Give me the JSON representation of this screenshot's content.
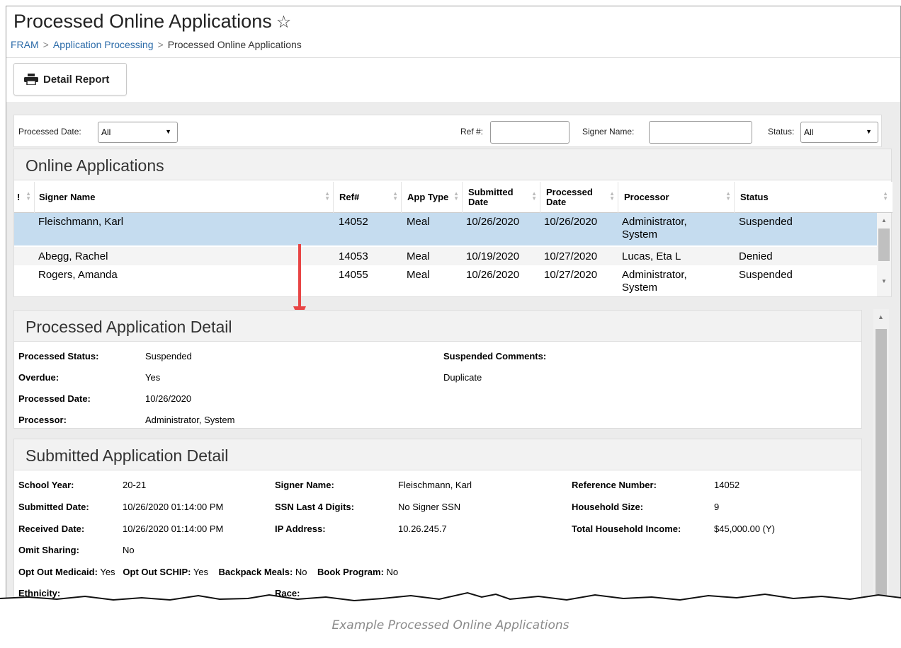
{
  "header": {
    "title": "Processed Online Applications",
    "breadcrumb": [
      "FRAM",
      "Application Processing",
      "Processed Online Applications"
    ]
  },
  "toolbar": {
    "detail_report_label": "Detail Report"
  },
  "filters": {
    "processed_date_label": "Processed Date:",
    "processed_date_value": "All",
    "ref_label": "Ref #:",
    "signer_label": "Signer Name:",
    "status_label": "Status:",
    "status_value": "All"
  },
  "online_apps": {
    "title": "Online Applications",
    "columns": {
      "flag": "!",
      "signer": "Signer Name",
      "ref": "Ref#",
      "apptype": "App Type",
      "submitted": "Submitted Date",
      "processed": "Processed Date",
      "processor": "Processor",
      "status": "Status"
    },
    "rows": [
      {
        "signer": "Fleischmann, Karl",
        "ref": "14052",
        "apptype": "Meal",
        "submitted": "10/26/2020",
        "processed": "10/26/2020",
        "processor": "Administrator, System",
        "status": "Suspended"
      },
      {
        "signer": "Abegg, Rachel",
        "ref": "14053",
        "apptype": "Meal",
        "submitted": "10/19/2020",
        "processed": "10/27/2020",
        "processor": "Lucas, Eta L",
        "status": "Denied"
      },
      {
        "signer": "Rogers, Amanda",
        "ref": "14055",
        "apptype": "Meal",
        "submitted": "10/26/2020",
        "processed": "10/27/2020",
        "processor": "Administrator, System",
        "status": "Suspended"
      }
    ]
  },
  "processed_detail": {
    "title": "Processed Application Detail",
    "status_label": "Processed Status:",
    "status_value": "Suspended",
    "overdue_label": "Overdue:",
    "overdue_value": "Yes",
    "date_label": "Processed Date:",
    "date_value": "10/26/2020",
    "processor_label": "Processor:",
    "processor_value": "Administrator, System",
    "comments_label": "Suspended Comments:",
    "comments_value": "Duplicate"
  },
  "submitted_detail": {
    "title": "Submitted Application Detail",
    "school_year_label": "School Year:",
    "school_year_value": "20-21",
    "submitted_label": "Submitted Date:",
    "submitted_value": "10/26/2020 01:14:00 PM",
    "received_label": "Received Date:",
    "received_value": "10/26/2020 01:14:00 PM",
    "omit_label": "Omit Sharing:",
    "omit_value": "No",
    "signer_label": "Signer Name:",
    "signer_value": "Fleischmann, Karl",
    "ssn_label": "SSN Last 4 Digits:",
    "ssn_value": "No Signer SSN",
    "ip_label": "IP Address:",
    "ip_value": "10.26.245.7",
    "refnum_label": "Reference Number:",
    "refnum_value": "14052",
    "hh_size_label": "Household Size:",
    "hh_size_value": "9",
    "income_label": "Total Household Income:",
    "income_value": "$45,000.00 (Y)",
    "medicaid_label": "Opt Out Medicaid:",
    "medicaid_value": "Yes",
    "schip_label": "Opt Out SCHIP:",
    "schip_value": "Yes",
    "backpack_label": "Backpack Meals:",
    "backpack_value": "No",
    "book_label": "Book Program:",
    "book_value": "No",
    "ethnicity_label": "Ethnicity:",
    "race_label": "Race:"
  },
  "caption": "Example Processed Online Applications"
}
